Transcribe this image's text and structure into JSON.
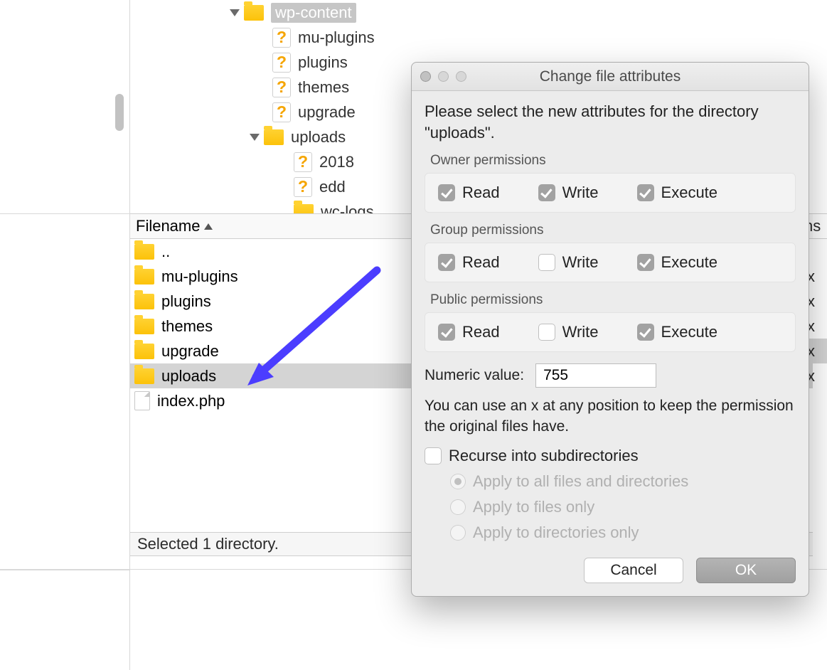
{
  "tree": {
    "root": {
      "name": "wp-content",
      "selected": true
    },
    "children": [
      {
        "name": "mu-plugins",
        "icon": "q"
      },
      {
        "name": "plugins",
        "icon": "q"
      },
      {
        "name": "themes",
        "icon": "q"
      },
      {
        "name": "upgrade",
        "icon": "q"
      },
      {
        "name": "uploads",
        "icon": "folder",
        "expanded": true,
        "children": [
          {
            "name": "2018",
            "icon": "q"
          },
          {
            "name": "edd",
            "icon": "q"
          },
          {
            "name": "wc-logs",
            "icon": "folder"
          }
        ]
      }
    ]
  },
  "filelist": {
    "header": "Filename",
    "items": [
      {
        "name": "..",
        "icon": "folder"
      },
      {
        "name": "mu-plugins",
        "icon": "folder"
      },
      {
        "name": "plugins",
        "icon": "folder"
      },
      {
        "name": "themes",
        "icon": "folder"
      },
      {
        "name": "upgrade",
        "icon": "folder"
      },
      {
        "name": "uploads",
        "icon": "folder",
        "selected": true
      },
      {
        "name": "index.php",
        "icon": "file"
      }
    ],
    "rightcol_header": "ns",
    "rightcol_values": [
      "",
      "x",
      "x",
      "x",
      "x",
      "x",
      ""
    ]
  },
  "status": "Selected 1 directory.",
  "dialog": {
    "title": "Change file attributes",
    "instruction": "Please select the new attributes for the directory \"uploads\".",
    "groups": {
      "owner": {
        "label": "Owner permissions",
        "read": true,
        "write": true,
        "execute": true
      },
      "group": {
        "label": "Group permissions",
        "read": true,
        "write": false,
        "execute": true
      },
      "public": {
        "label": "Public permissions",
        "read": true,
        "write": false,
        "execute": true
      }
    },
    "labels": {
      "read": "Read",
      "write": "Write",
      "execute": "Execute"
    },
    "numeric_label": "Numeric value:",
    "numeric_value": "755",
    "hint": "You can use an x at any position to keep the permission the original files have.",
    "recurse_label": "Recurse into subdirectories",
    "recurse_checked": false,
    "radios": {
      "all": "Apply to all files and directories",
      "files": "Apply to files only",
      "dirs": "Apply to directories only",
      "selected": "all"
    },
    "buttons": {
      "cancel": "Cancel",
      "ok": "OK"
    }
  }
}
